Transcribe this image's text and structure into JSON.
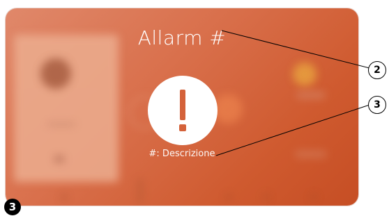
{
  "alarm": {
    "title": "Allarm #",
    "description": "#: Descrizione"
  },
  "callouts": {
    "title_marker": "2",
    "description_marker": "3"
  },
  "figure_badge": "3",
  "icons": {
    "alert": "exclamation-icon"
  },
  "colors": {
    "panel_start": "#e0886a",
    "panel_end": "#c64e24",
    "alert_fill": "#ffffff",
    "alert_mark": "#d4623a"
  }
}
